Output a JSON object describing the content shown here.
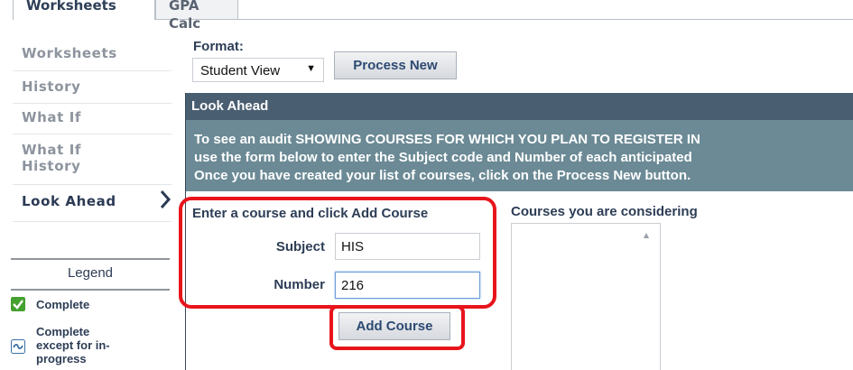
{
  "tabs": [
    {
      "label": "Worksheets",
      "active": true
    },
    {
      "label": "GPA Calc",
      "active": false
    }
  ],
  "sidebar": {
    "items": [
      {
        "label": "Worksheets"
      },
      {
        "label": "History"
      },
      {
        "label": "What If"
      },
      {
        "label": "What If History"
      },
      {
        "label": "Look Ahead",
        "active": true
      }
    ]
  },
  "legend": {
    "title": "Legend",
    "items": [
      {
        "label": "Complete",
        "icon": "checkmark-icon",
        "color": "#45a12f"
      },
      {
        "label": "Complete except for in-progress",
        "icon": "tilde-icon",
        "color": "#3b6fa6"
      }
    ]
  },
  "format": {
    "label": "Format:",
    "selected": "Student View",
    "process_button": "Process New"
  },
  "look_ahead": {
    "title": "Look Ahead",
    "instructions": [
      "To see an audit SHOWING COURSES FOR WHICH YOU PLAN TO REGISTER IN",
      "use the form below to enter the Subject code and Number of each anticipated",
      "Once you have created your list of courses, click on the Process New button."
    ],
    "enter_label": "Enter a course and click Add Course",
    "subject_label": "Subject",
    "subject_value": "HIS",
    "number_label": "Number",
    "number_value": "216",
    "add_button": "Add Course",
    "considering_label": "Courses you are considering"
  },
  "colors": {
    "panel_header": "#495e71",
    "panel_info": "#6b8a95",
    "highlight": "#e8141c"
  }
}
